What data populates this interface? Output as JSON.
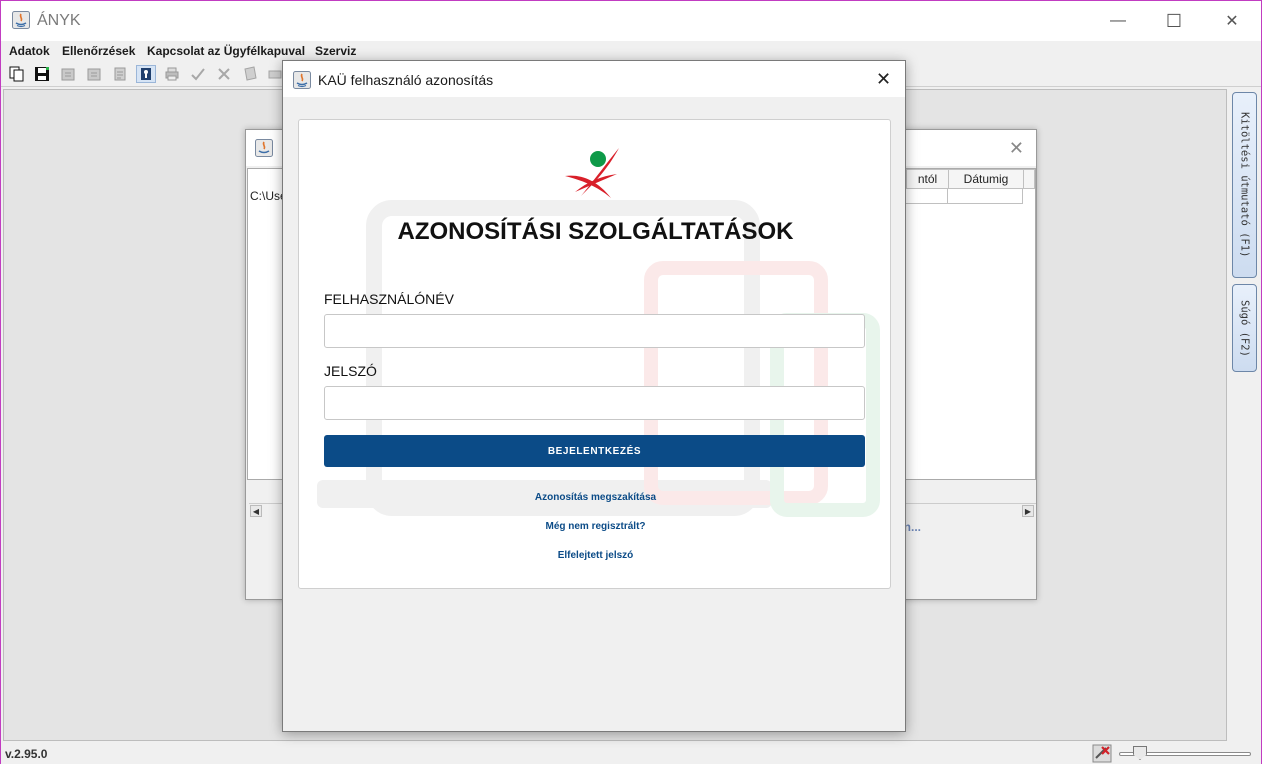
{
  "app": {
    "title": "ÁNYK",
    "version": "v.2.95.0"
  },
  "window_controls": {
    "minimize": "—",
    "maximize": "☐",
    "close": "✕"
  },
  "menu": [
    {
      "label": "Adatok"
    },
    {
      "label": "Ellenőrzések"
    },
    {
      "label": "Kapcsolat az Ügyfélkapuval"
    },
    {
      "label": "Szerviz"
    }
  ],
  "toolbar": {
    "buttons": [
      "copy-icon",
      "save-icon",
      "disabled-icon",
      "disabled-icon",
      "disabled-icon",
      "key-icon",
      "print-icon",
      "check-icon",
      "cross-icon",
      "disabled-icon",
      "disabled-icon"
    ]
  },
  "side_tabs": [
    {
      "label": "Kitöltési útmutató (F1)"
    },
    {
      "label": "Súgó (F2)"
    }
  ],
  "background_dialog": {
    "path": "C:\\Use",
    "columns": [
      "ntól",
      "Dátumig"
    ],
    "link": "atban..."
  },
  "kau_dialog": {
    "title": "KAÜ felhasználó azonosítás",
    "close": "✕",
    "heading": "AZONOSÍTÁSI SZOLGÁLTATÁSOK",
    "username_label": "FELHASZNÁLÓNÉV",
    "username_value": "",
    "password_label": "JELSZÓ",
    "password_value": "",
    "login_button": "BEJELENTKEZÉS",
    "cancel_link": "Azonosítás megszakítása",
    "register_link": "Még nem regisztrált?",
    "forgot_link": "Elfelejtett jelszó"
  },
  "colors": {
    "accent": "#0b4b87",
    "logo_red": "#d9202a",
    "logo_green": "#0e9a48"
  }
}
